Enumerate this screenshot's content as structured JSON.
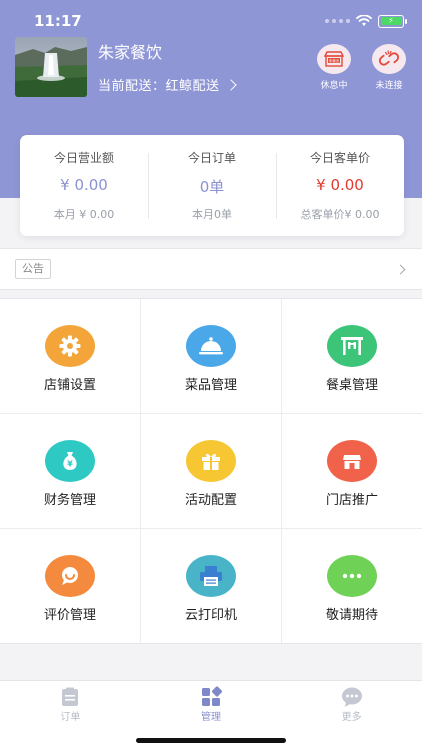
{
  "status_bar": {
    "time": "11:17"
  },
  "header": {
    "shop_name": "朱家餐饮",
    "delivery_text": "当前配送：红鲸配送",
    "rest_button_badge": "未营业",
    "rest_button_label": "休息中",
    "connect_button_label": "未连接"
  },
  "stats": [
    {
      "title": "今日营业额",
      "value": "¥ 0.00",
      "sub": "本月 ¥ 0.00"
    },
    {
      "title": "今日订单",
      "value": "0单",
      "sub": "本月0单"
    },
    {
      "title": "今日客单价",
      "value": "¥ 0.00",
      "sub": "总客单价¥ 0.00"
    }
  ],
  "notice": {
    "tag": "公告"
  },
  "menu": [
    {
      "label": "店铺设置",
      "icon": "gear-icon",
      "color": "#f4a53a"
    },
    {
      "label": "菜品管理",
      "icon": "food-cloche-icon",
      "color": "#4aa8e8"
    },
    {
      "label": "餐桌管理",
      "icon": "table-icon",
      "color": "#3cc479"
    },
    {
      "label": "财务管理",
      "icon": "money-bag-icon",
      "color": "#2fc9c3"
    },
    {
      "label": "活动配置",
      "icon": "gift-icon",
      "color": "#f6c633"
    },
    {
      "label": "门店推广",
      "icon": "store-promotion-icon",
      "color": "#f1624a"
    },
    {
      "label": "评价管理",
      "icon": "comment-icon",
      "color": "#f48a3d"
    },
    {
      "label": "云打印机",
      "icon": "printer-icon",
      "color": "#49b4c7"
    },
    {
      "label": "敬请期待",
      "icon": "more-dots-icon",
      "color": "#6fd256"
    }
  ],
  "tabs": [
    {
      "label": "订单",
      "icon": "order-clipboard-icon",
      "active": false
    },
    {
      "label": "管理",
      "icon": "manage-grid-icon",
      "active": true
    },
    {
      "label": "更多",
      "icon": "more-bubble-icon",
      "active": false
    }
  ],
  "colors": {
    "header_bg": "#8f96d6",
    "accent": "#8b93cf",
    "price_red": "#e23a2e"
  }
}
